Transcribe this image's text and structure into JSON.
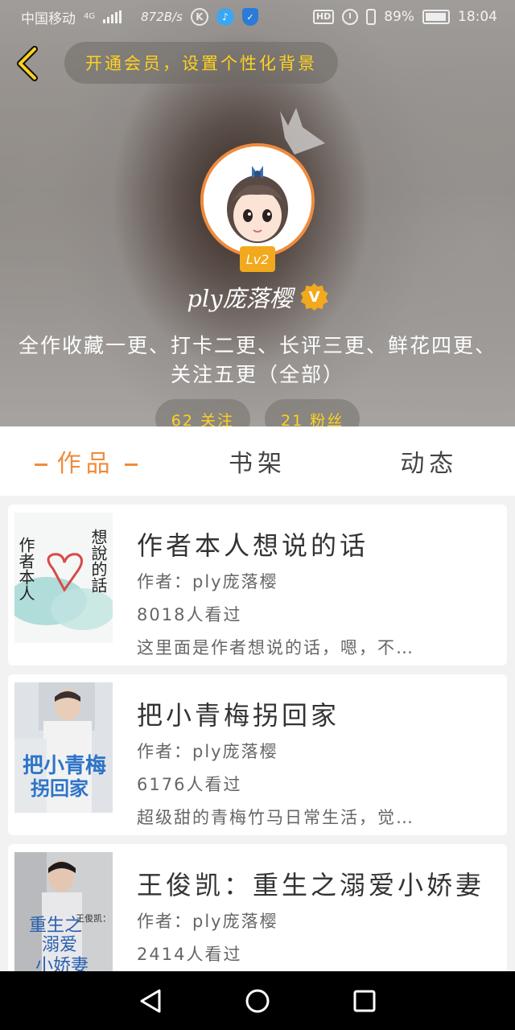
{
  "status_bar": {
    "carrier": "中国移动",
    "network": "4G",
    "speed": "872B/s",
    "battery": "89%",
    "time": "18:04",
    "hd_label": "HD"
  },
  "header": {
    "vip_prompt": "开通会员，设置个性化背景",
    "level": "Lv2",
    "username": "ply庞落樱",
    "verified_badge": "V",
    "bio": "全作收藏一更、打卡二更、长评三更、鲜花四更、关注五更（全部）",
    "following": "62 关注",
    "followers": "21 粉丝"
  },
  "tabs": [
    {
      "label": "作品",
      "active": true
    },
    {
      "label": "书架",
      "active": false
    },
    {
      "label": "动态",
      "active": false
    }
  ],
  "books": [
    {
      "title": "作者本人想说的话",
      "author": "作者：ply庞落樱",
      "views": "8018人看过",
      "summary": "这里面是作者想说的话，嗯，不…",
      "cover_text_left": "作者本人",
      "cover_text_right": "想說的話"
    },
    {
      "title": "把小青梅拐回家",
      "author": "作者：ply庞落樱",
      "views": "6176人看过",
      "summary": "超级甜的青梅竹马日常生活，觉…",
      "cover_text": "把小青梅拐回家"
    },
    {
      "title": "王俊凯：重生之溺爱小娇妻",
      "author": "作者：ply庞落樱",
      "views": "2414人看过",
      "summary": "",
      "cover_text": "重生之溺爱小娇妻",
      "cover_caption": "王俊凯："
    }
  ],
  "colors": {
    "accent": "#f08b3c",
    "gold": "#ffd21f",
    "badge": "#f2a91e"
  }
}
